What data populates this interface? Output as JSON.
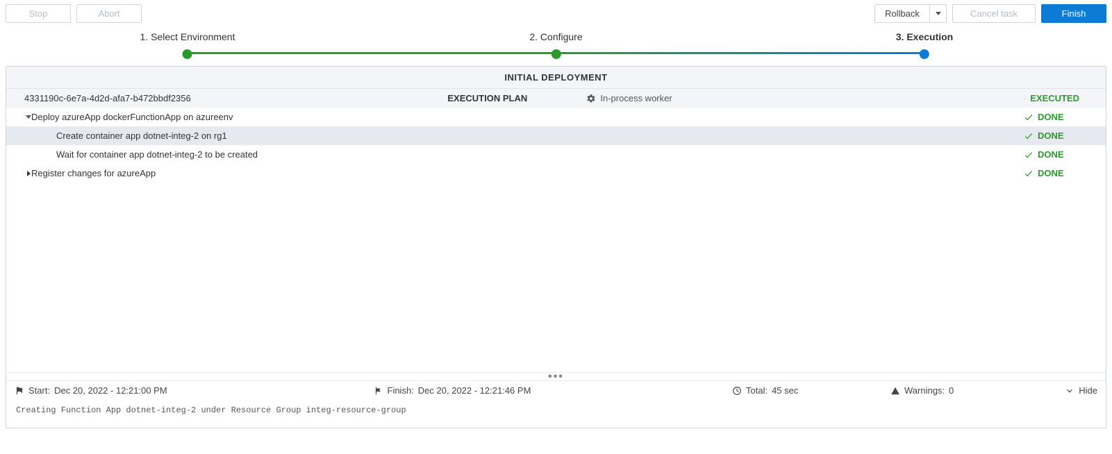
{
  "toolbar": {
    "stop_label": "Stop",
    "abort_label": "Abort",
    "rollback_label": "Rollback",
    "cancel_task_label": "Cancel task",
    "finish_label": "Finish"
  },
  "steps": {
    "step1": "1. Select Environment",
    "step2": "2. Configure",
    "step3": "3. Execution"
  },
  "deployment": {
    "title": "INITIAL DEPLOYMENT",
    "plan_id": "4331190c-6e7a-4d2d-afa7-b472bbdf2356",
    "plan_center_label": "EXECUTION PLAN",
    "worker_label": "In-process worker",
    "plan_status": "EXECUTED",
    "tasks": [
      {
        "expanded": true,
        "indent": 1,
        "label": "Deploy azureApp dockerFunctionApp on azureenv",
        "status": "DONE",
        "selected": false
      },
      {
        "expanded": null,
        "indent": 2,
        "label": "Create container app dotnet-integ-2 on rg1",
        "status": "DONE",
        "selected": true
      },
      {
        "expanded": null,
        "indent": 2,
        "label": "Wait for container app dotnet-integ-2 to be created",
        "status": "DONE",
        "selected": false
      },
      {
        "expanded": false,
        "indent": 1,
        "label": "Register changes for azureApp",
        "status": "DONE",
        "selected": false
      }
    ]
  },
  "statusbar": {
    "start_prefix": "Start:",
    "start_value": "Dec 20, 2022 - 12:21:00 PM",
    "finish_prefix": "Finish:",
    "finish_value": "Dec 20, 2022 - 12:21:46 PM",
    "total_prefix": "Total:",
    "total_value": "45 sec",
    "warnings_prefix": "Warnings:",
    "warnings_value": "0",
    "hide_label": "Hide"
  },
  "log": "Creating Function App dotnet-integ-2 under Resource Group integ-resource-group"
}
